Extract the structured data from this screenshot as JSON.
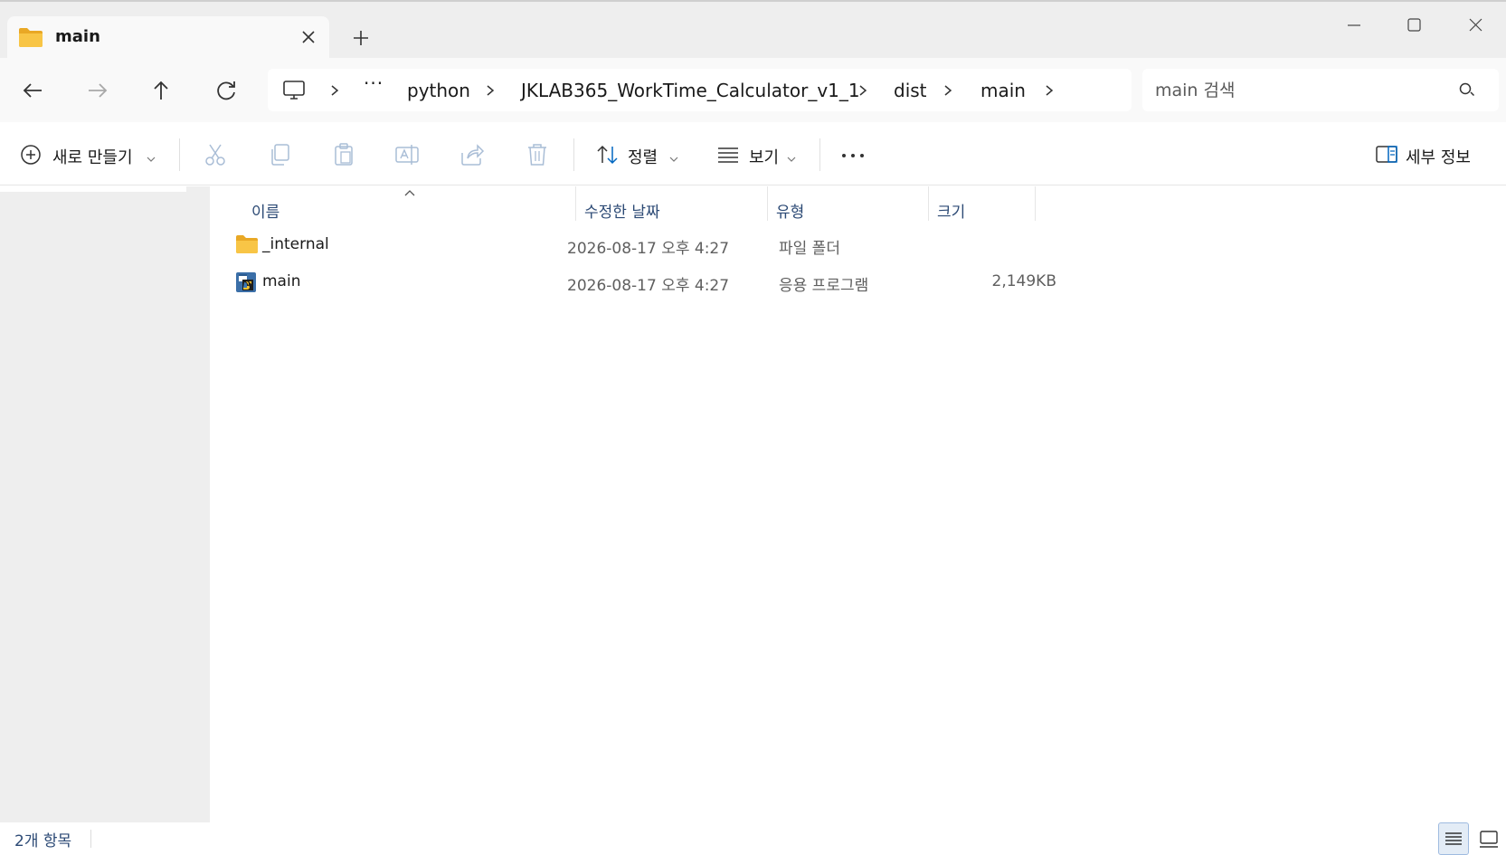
{
  "tab": {
    "title": "main"
  },
  "address": {
    "more": "···",
    "crumbs": [
      "python",
      "JKLAB365_WorkTime_Calculator_v1_1",
      "dist",
      "main"
    ]
  },
  "search": {
    "placeholder": "main 검색"
  },
  "commandbar": {
    "new_label": "새로 만들기",
    "sort_label": "정렬",
    "view_label": "보기",
    "details_label": "세부 정보"
  },
  "columns": {
    "name": "이름",
    "date": "수정한 날짜",
    "type": "유형",
    "size": "크기"
  },
  "files": [
    {
      "name": "_internal",
      "date": "2026-08-17 오후 4:27",
      "type": "파일 폴더",
      "size": "",
      "icon": "folder-icon"
    },
    {
      "name": "main",
      "date": "2026-08-17 오후 4:27",
      "type": "응용 프로그램",
      "size": "2,149KB",
      "icon": "python-app-icon"
    }
  ],
  "status": {
    "count": "2개 항목"
  },
  "colors": {
    "accent": "#0067c0",
    "header_text": "#2c4a75",
    "folder": "#f8c546"
  }
}
